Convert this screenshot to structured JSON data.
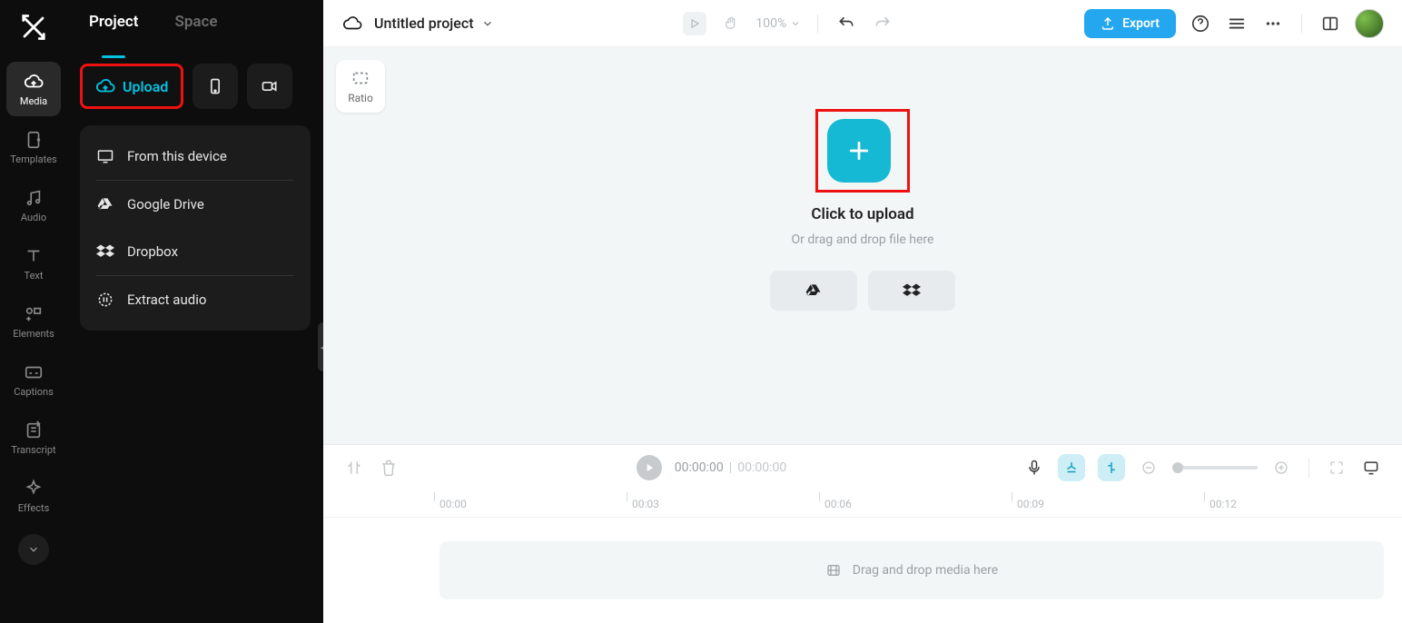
{
  "rail": {
    "items": [
      {
        "label": "Media"
      },
      {
        "label": "Templates"
      },
      {
        "label": "Audio"
      },
      {
        "label": "Text"
      },
      {
        "label": "Elements"
      },
      {
        "label": "Captions"
      },
      {
        "label": "Transcript"
      },
      {
        "label": "Effects"
      }
    ]
  },
  "panel": {
    "tabs": {
      "project": "Project",
      "space": "Space"
    },
    "upload_label": "Upload",
    "menu": {
      "from_device": "From this device",
      "google_drive": "Google Drive",
      "dropbox": "Dropbox",
      "extract_audio": "Extract audio"
    }
  },
  "topbar": {
    "project_name": "Untitled project",
    "zoom": "100%",
    "export_label": "Export"
  },
  "canvas": {
    "ratio_label": "Ratio",
    "click_title": "Click to upload",
    "drag_sub": "Or drag and drop file here"
  },
  "timeline": {
    "current": "00:00:00",
    "total": "00:00:00",
    "ruler": [
      "00:00",
      "00:03",
      "00:06",
      "00:09",
      "00:12"
    ],
    "drop_text": "Drag and drop media here"
  }
}
